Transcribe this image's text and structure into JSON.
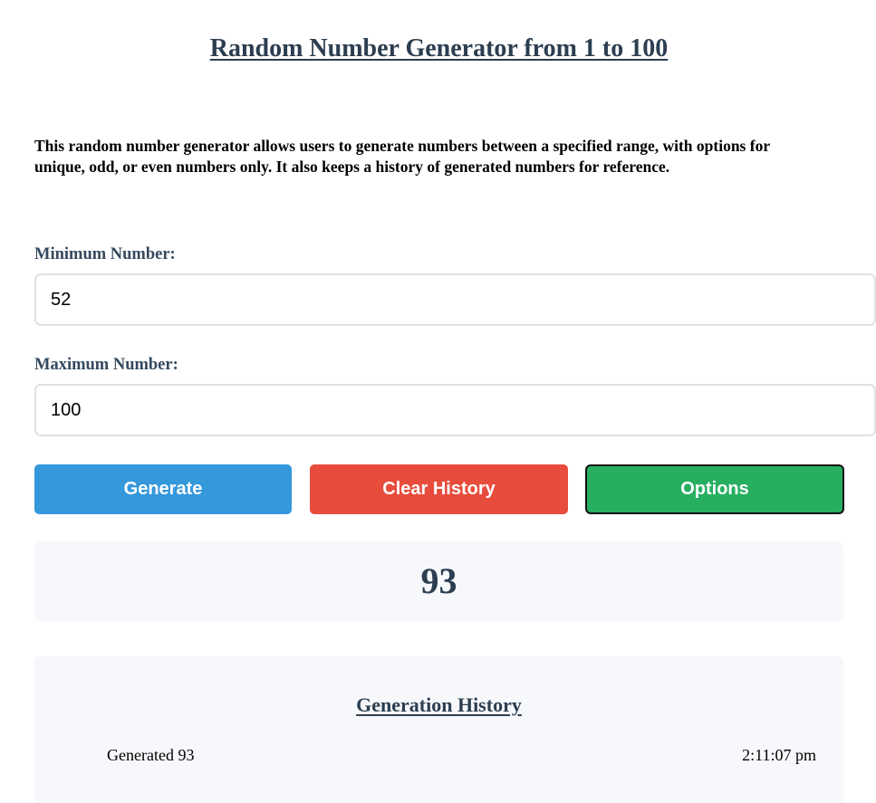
{
  "header": {
    "title": "Random Number Generator from 1 to 100"
  },
  "description": "This random number generator allows users to generate numbers between a specified range, with options for unique, odd, or even numbers only. It also keeps a history of generated numbers for reference.",
  "form": {
    "min_label": "Minimum Number:",
    "min_value": "52",
    "max_label": "Maximum Number:",
    "max_value": "100"
  },
  "buttons": {
    "generate_label": "Generate",
    "clear_label": "Clear History",
    "options_label": "Options"
  },
  "result": {
    "value": "93"
  },
  "history": {
    "title": "Generation History",
    "entries": [
      {
        "text": "Generated 93",
        "time": "2:11:07 pm"
      }
    ]
  },
  "colors": {
    "generate": "#3498db",
    "clear": "#e74c3c",
    "options": "#27ae60",
    "heading": "#2c3e50",
    "panel_background": "#f6f8fb"
  }
}
